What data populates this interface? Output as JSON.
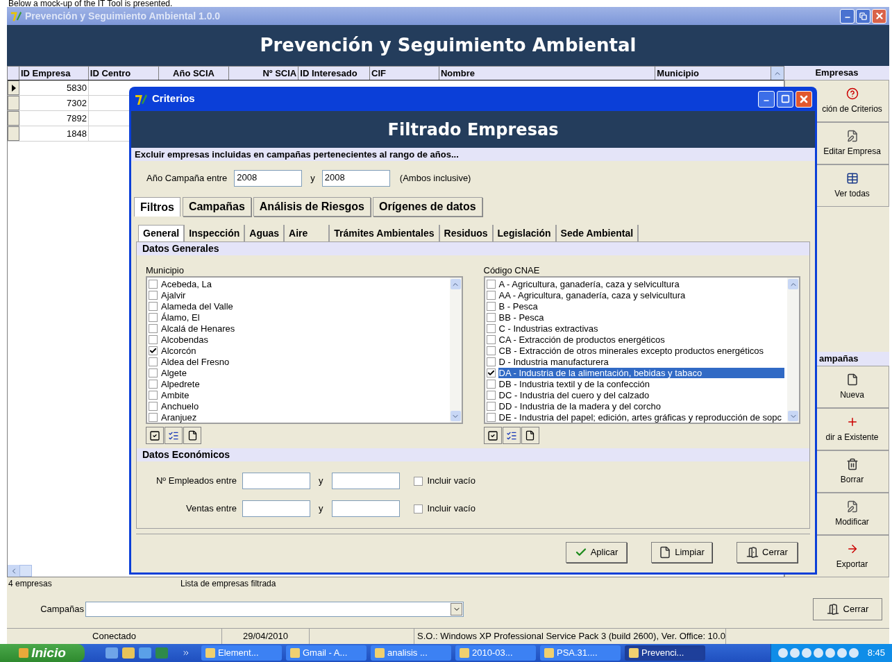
{
  "caption": "Below a mock-up of the IT Tool is presented.",
  "window": {
    "title": "Prevención y Seguimiento Ambiental 1.0.0"
  },
  "header": "Prevención y Seguimiento Ambiental",
  "grid": {
    "columns": [
      {
        "label": "ID Empresa"
      },
      {
        "label": "ID Centro"
      },
      {
        "label": "Año SCIA"
      },
      {
        "label": "Nº SCIA"
      },
      {
        "label": "ID Interesado"
      },
      {
        "label": "CIF"
      },
      {
        "label": "Nombre"
      },
      {
        "label": "Municipio"
      }
    ],
    "rows": [
      {
        "id_empresa": "5830",
        "selected": true
      },
      {
        "id_empresa": "7302",
        "selected": false
      },
      {
        "id_empresa": "7892",
        "selected": false
      },
      {
        "id_empresa": "1848",
        "selected": false
      }
    ]
  },
  "empresas_panel": {
    "title": "Empresas",
    "buttons": [
      {
        "label": "ción de Criterios"
      },
      {
        "label": "Editar Empresa"
      },
      {
        "label": "Ver todas"
      }
    ]
  },
  "campanas_panel": {
    "title": "ampañas",
    "buttons": [
      {
        "label": "Nueva"
      },
      {
        "label": "dir a Existente"
      },
      {
        "label": "Borrar"
      },
      {
        "label": "Modificar"
      },
      {
        "label": "Exportar"
      }
    ]
  },
  "status": {
    "count": "4 empresas",
    "message": "Lista de empresas filtrada"
  },
  "campanas_field": {
    "label": "Campañas"
  },
  "close_button": "Cerrar",
  "status_bar": [
    "Conectado",
    "29/04/2010",
    "S.O.: Windows XP Professional Service Pack 3 (build 2600), Ver. Office: 10.0"
  ],
  "dialog": {
    "title": "Criterios",
    "header": "Filtrado Empresas",
    "note": "Excluir empresas incluidas en campañas pertenecientes al rango de años...",
    "year_label": "Año Campaña entre",
    "year_from": "2008",
    "year_and": "y",
    "year_to": "2008",
    "year_hint": "(Ambos inclusive)",
    "tabs": [
      {
        "label": "Filtros",
        "selected": true
      },
      {
        "label": "Campañas",
        "selected": false
      },
      {
        "label": "Análisis de Riesgos",
        "selected": false
      },
      {
        "label": "Orígenes de datos",
        "selected": false
      }
    ],
    "subtabs": [
      {
        "label": "General",
        "selected": true
      },
      {
        "label": "Inspección",
        "selected": false
      },
      {
        "label": "Aguas",
        "selected": false
      },
      {
        "label": "Aire",
        "selected": false
      },
      {
        "label": "Trámites Ambientales",
        "selected": false
      },
      {
        "label": "Residuos",
        "selected": false
      },
      {
        "label": "Legislación",
        "selected": false
      },
      {
        "label": "Sede Ambiental",
        "selected": false
      }
    ],
    "general_title": "Datos Generales",
    "lists": [
      {
        "label": "Municipio",
        "items": [
          {
            "label": "Acebeda, La",
            "checked": false,
            "selected": false
          },
          {
            "label": "Ajalvir",
            "checked": false,
            "selected": false
          },
          {
            "label": "Alameda del Valle",
            "checked": false,
            "selected": false
          },
          {
            "label": "Álamo, El",
            "checked": false,
            "selected": false
          },
          {
            "label": "Alcalá de Henares",
            "checked": false,
            "selected": false
          },
          {
            "label": "Alcobendas",
            "checked": false,
            "selected": false
          },
          {
            "label": "Alcorcón",
            "checked": true,
            "selected": false
          },
          {
            "label": "Aldea del Fresno",
            "checked": false,
            "selected": false
          },
          {
            "label": "Algete",
            "checked": false,
            "selected": false
          },
          {
            "label": "Alpedrete",
            "checked": false,
            "selected": false
          },
          {
            "label": "Ambite",
            "checked": false,
            "selected": false
          },
          {
            "label": "Anchuelo",
            "checked": false,
            "selected": false
          },
          {
            "label": "Aranjuez",
            "checked": false,
            "selected": false
          }
        ]
      },
      {
        "label": "Código CNAE",
        "items": [
          {
            "label": "A - Agricultura,  ganadería, caza y selvicultura",
            "checked": false,
            "selected": false
          },
          {
            "label": "AA - Agricultura, ganadería, caza y selvicultura",
            "checked": false,
            "selected": false
          },
          {
            "label": "B - Pesca",
            "checked": false,
            "selected": false
          },
          {
            "label": "BB - Pesca",
            "checked": false,
            "selected": false
          },
          {
            "label": "C - Industrias extractivas",
            "checked": false,
            "selected": false
          },
          {
            "label": "CA - Extracción de productos energéticos",
            "checked": false,
            "selected": false
          },
          {
            "label": "CB - Extracción de otros minerales excepto productos energéticos",
            "checked": false,
            "selected": false
          },
          {
            "label": "D - Industria manufacturera",
            "checked": false,
            "selected": false
          },
          {
            "label": "DA - Industria de la alimentación, bebidas y tabaco",
            "checked": true,
            "selected": true
          },
          {
            "label": "DB - Industria textil y de la confección",
            "checked": false,
            "selected": false
          },
          {
            "label": "DC - Industria del cuero y del calzado",
            "checked": false,
            "selected": false
          },
          {
            "label": "DD - Industria de la madera y del corcho",
            "checked": false,
            "selected": false
          },
          {
            "label": "DE - Industria del papel; edición, artes gráficas y reproducción de sopc",
            "checked": false,
            "selected": false
          }
        ]
      }
    ],
    "economic_title": "Datos Económicos",
    "ranges": [
      {
        "label": "Nº Empleados entre",
        "and": "y",
        "empty_label": "Incluir vacío",
        "checked": false
      },
      {
        "label": "Ventas entre",
        "and": "y",
        "empty_label": "Incluir vacío",
        "checked": false
      }
    ],
    "buttons": [
      {
        "label": "Aplicar"
      },
      {
        "label": "Limpiar"
      },
      {
        "label": "Cerrar"
      }
    ]
  },
  "taskbar": {
    "start": "Inicio",
    "tasks": [
      {
        "label": "Element...",
        "selected": false
      },
      {
        "label": "Gmail - A...",
        "selected": false
      },
      {
        "label": "analisis ...",
        "selected": false
      },
      {
        "label": "2010-03...",
        "selected": false
      },
      {
        "label": "PSA.31....",
        "selected": false
      },
      {
        "label": "Prevenci...",
        "selected": true
      }
    ],
    "clock": "8:45"
  }
}
